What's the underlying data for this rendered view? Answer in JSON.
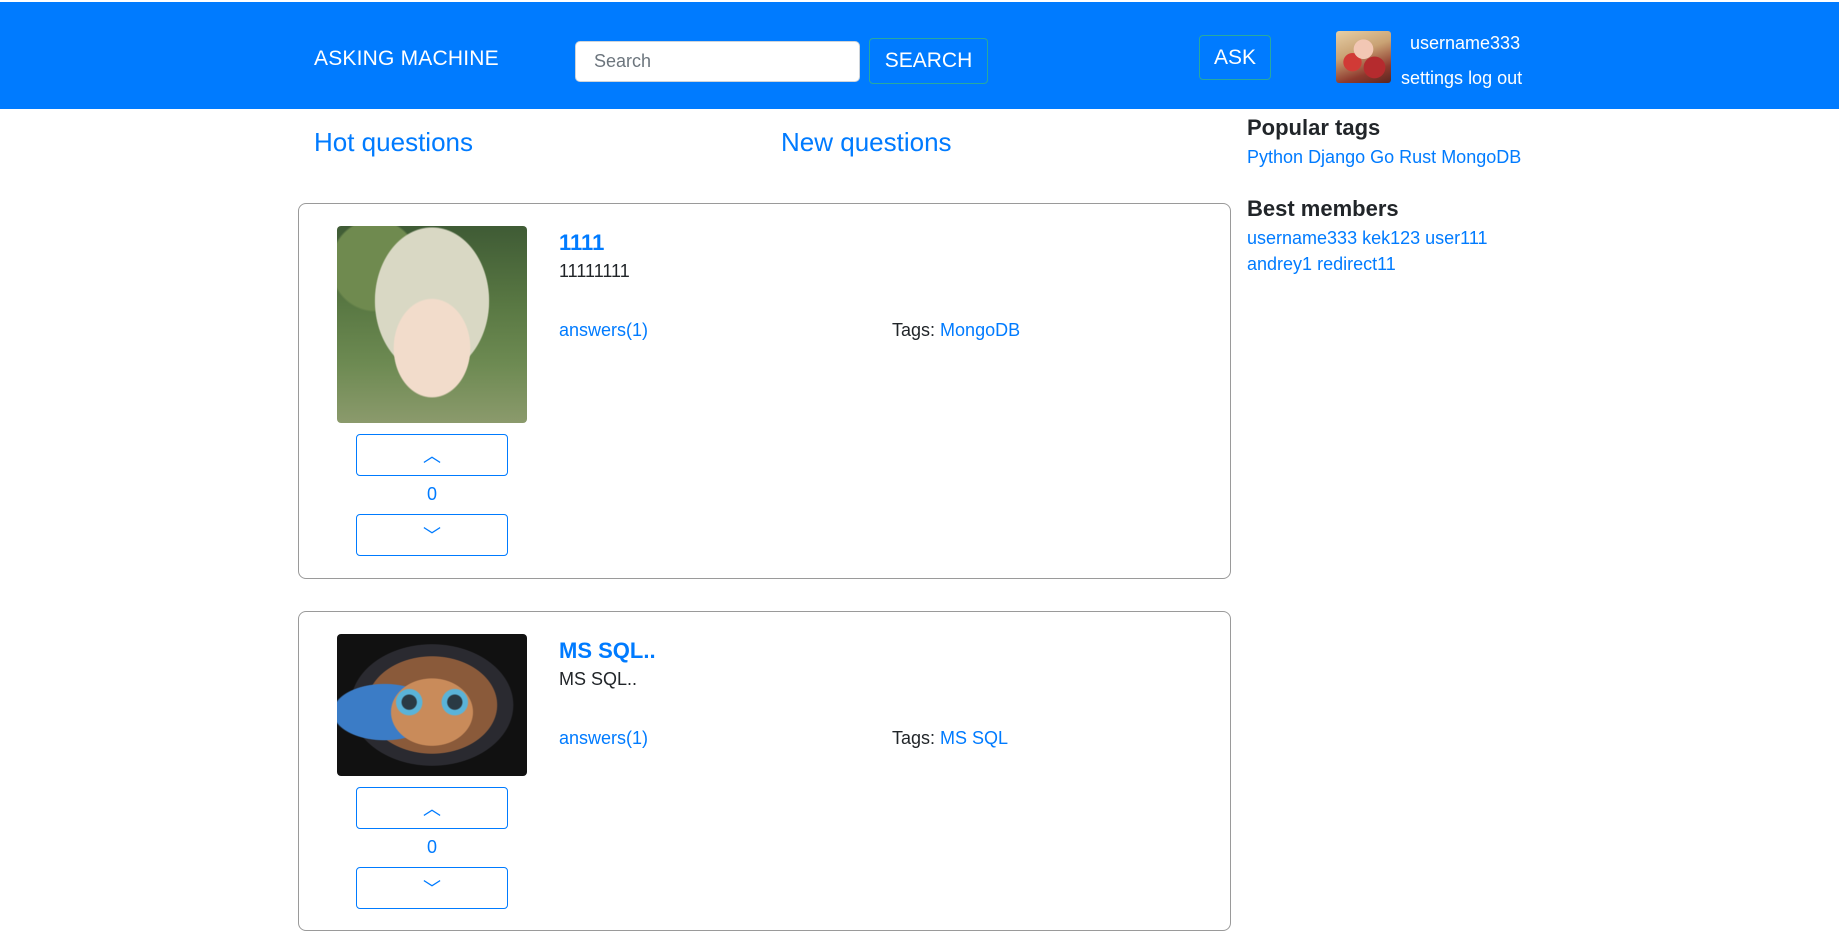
{
  "header": {
    "brand": "ASKING MACHINE",
    "search_placeholder": "Search",
    "search_button": "SEARCH",
    "ask_button": "ASK",
    "username": "username333",
    "settings_link": "settings",
    "logout_link": "log out"
  },
  "tabs": {
    "hot": "Hot questions",
    "new": "New questions"
  },
  "questions": [
    {
      "title": "1111",
      "body": "11111111",
      "answers": "answers(1)",
      "tags_label": "Tags:",
      "tags": [
        "MongoDB"
      ],
      "votes": "0",
      "up_icon": "︿",
      "down_icon": "﹀"
    },
    {
      "title": "MS SQL..",
      "body": "MS SQL..",
      "answers": "answers(1)",
      "tags_label": "Tags:",
      "tags": [
        "MS SQL"
      ],
      "votes": "0",
      "up_icon": "︿",
      "down_icon": "﹀"
    }
  ],
  "sidebar": {
    "popular_tags_title": "Popular tags",
    "popular_tags": [
      "Python",
      "Django",
      "Go",
      "Rust",
      "MongoDB"
    ],
    "best_members_title": "Best members",
    "best_members": [
      "username333",
      "kek123",
      "user111",
      "andrey1",
      "redirect11"
    ]
  },
  "colors": {
    "primary": "#007bff",
    "text": "#212529",
    "card_border": "#9a9a9a"
  }
}
